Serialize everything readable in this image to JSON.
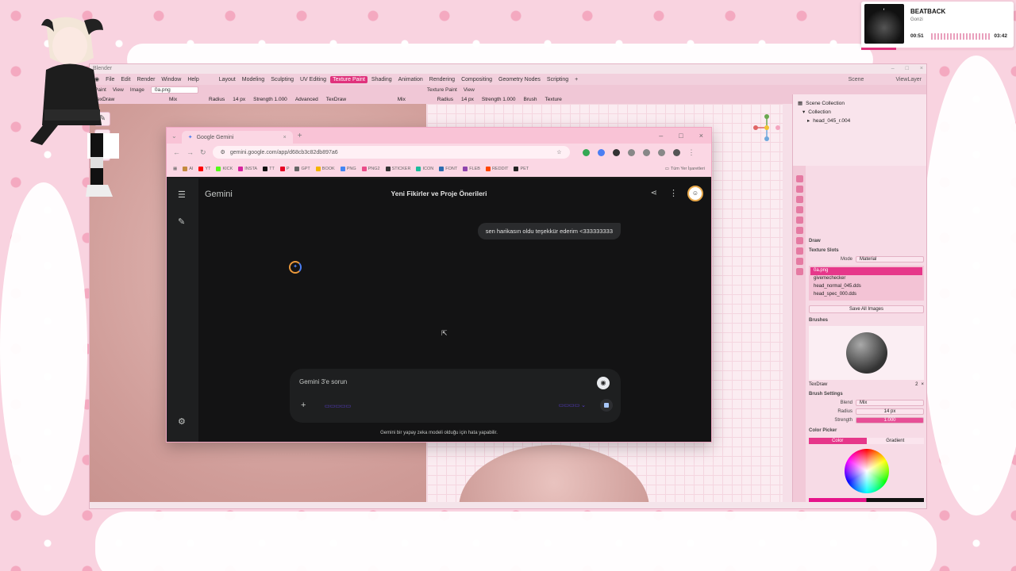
{
  "blender": {
    "app_title": "Blender",
    "menu": [
      "File",
      "Edit",
      "Render",
      "Window",
      "Help"
    ],
    "workspaces": [
      "Layout",
      "Modeling",
      "Sculpting",
      "UV Editing",
      "Texture Paint",
      "Shading",
      "Animation",
      "Rendering",
      "Compositing",
      "Geometry Nodes",
      "Scripting"
    ],
    "active_workspace": "Texture Paint",
    "scene_label": "Scene",
    "view_layer_label": "ViewLayer",
    "tool_header": {
      "mode": "Paint",
      "view": "View",
      "image": "Image",
      "image_name": "0a.png",
      "brush_name": "TexDraw",
      "blend": "Mix",
      "radius_label": "Radius",
      "radius_value": "14 px",
      "strength_label": "Strength",
      "strength_value": "1.000",
      "advanced": "Advanced"
    },
    "tool_header_right": {
      "mode": "Texture Paint",
      "view": "View",
      "brush_name": "TexDraw",
      "blend": "Mix",
      "radius_label": "Radius",
      "radius_value": "14 px",
      "strength_label": "Strength",
      "strength_value": "1.000",
      "brush": "Brush",
      "texture": "Texture"
    },
    "outliner": {
      "scene_collection": "Scene Collection",
      "collection": "Collection",
      "object": "head_045_r.004"
    },
    "props": {
      "tool_name": "Draw",
      "texture_slots_title": "Texture Slots",
      "mode_label": "Mode",
      "mode_value": "Material",
      "slots": [
        "0a.png",
        "givemechecker",
        "head_normal_045.dds",
        "head_spec_000.dds"
      ],
      "save_all": "Save All Images",
      "brushes_title": "Brushes",
      "brush_name": "TexDraw",
      "brush_users": "2",
      "brush_settings_title": "Brush Settings",
      "blend_label": "Blend",
      "blend_value": "Mix",
      "radius_label": "Radius",
      "radius_value": "14 px",
      "strength_label": "Strength",
      "strength_value": "1.000",
      "color_picker_title": "Color Picker",
      "color_tab": "Color",
      "gradient_tab": "Gradient"
    },
    "colors": {
      "accent": "#e0327c",
      "primary_color": "#e6148a",
      "secondary_color": "#111111"
    }
  },
  "browser": {
    "tab_title": "Google Gemini",
    "url": "gemini.google.com/app/d68cb3c82db897a6",
    "bookmarks": [
      "AI",
      "YT",
      "KICK",
      "INSTA",
      "TT",
      "P",
      "GPT",
      "BOOK",
      "PNG",
      "PNG2",
      "STICKER",
      "ICON",
      "FONT",
      "FLEB",
      "REDDIT",
      "PET"
    ],
    "bookmarks_all": "Tüm Yer İşaretleri"
  },
  "gemini": {
    "brand": "Gemini",
    "conversation_title": "Yeni Fikirler ve Proje Önerileri",
    "user_message": "sen harikasın oldu teşekkür ederim <333333333",
    "input_placeholder": "Gemini 3'e sorun",
    "disclaimer": "Gemini bir yapay zeka modeli olduğu için hata yapabilir."
  },
  "music": {
    "title": "BEATBACK",
    "artist": "Gonzi",
    "elapsed": "00:51",
    "duration": "03:42",
    "progress": 0.23
  }
}
